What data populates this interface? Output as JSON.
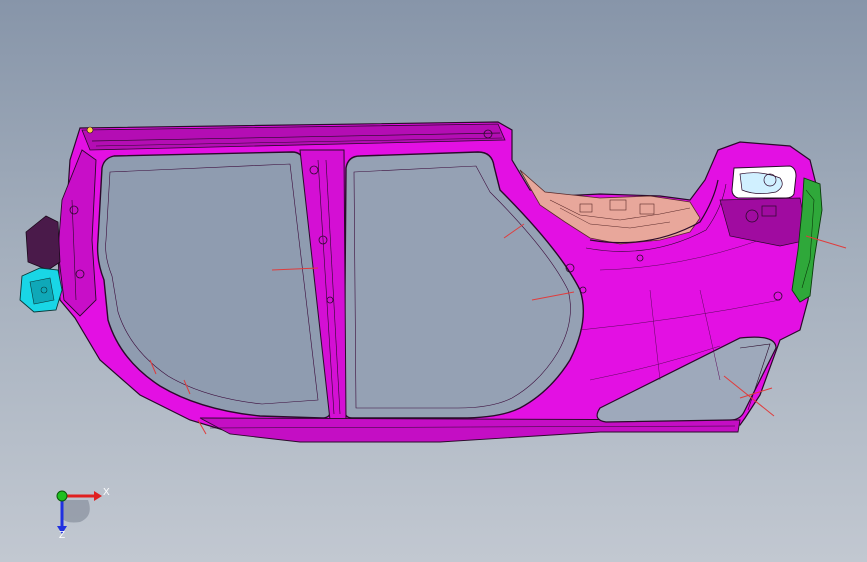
{
  "viewport": {
    "background_top": "#8795a9",
    "background_bottom": "#c2c8d1"
  },
  "model": {
    "part": "body-side-panel",
    "body_color": "#e310e3",
    "body_dark": "#7a087a",
    "edge_color": "#2a0a2a",
    "interior_part_color": "#e8a79b",
    "bracket_left_color": "#19d6e6",
    "bracket_right_color": "#2fa83a",
    "annotation_line_color": "#e03c3c"
  },
  "triad": {
    "x_label": "X",
    "z_label": "Z",
    "x_color": "#e02020",
    "y_color": "#20c020",
    "z_color": "#2030e0"
  }
}
